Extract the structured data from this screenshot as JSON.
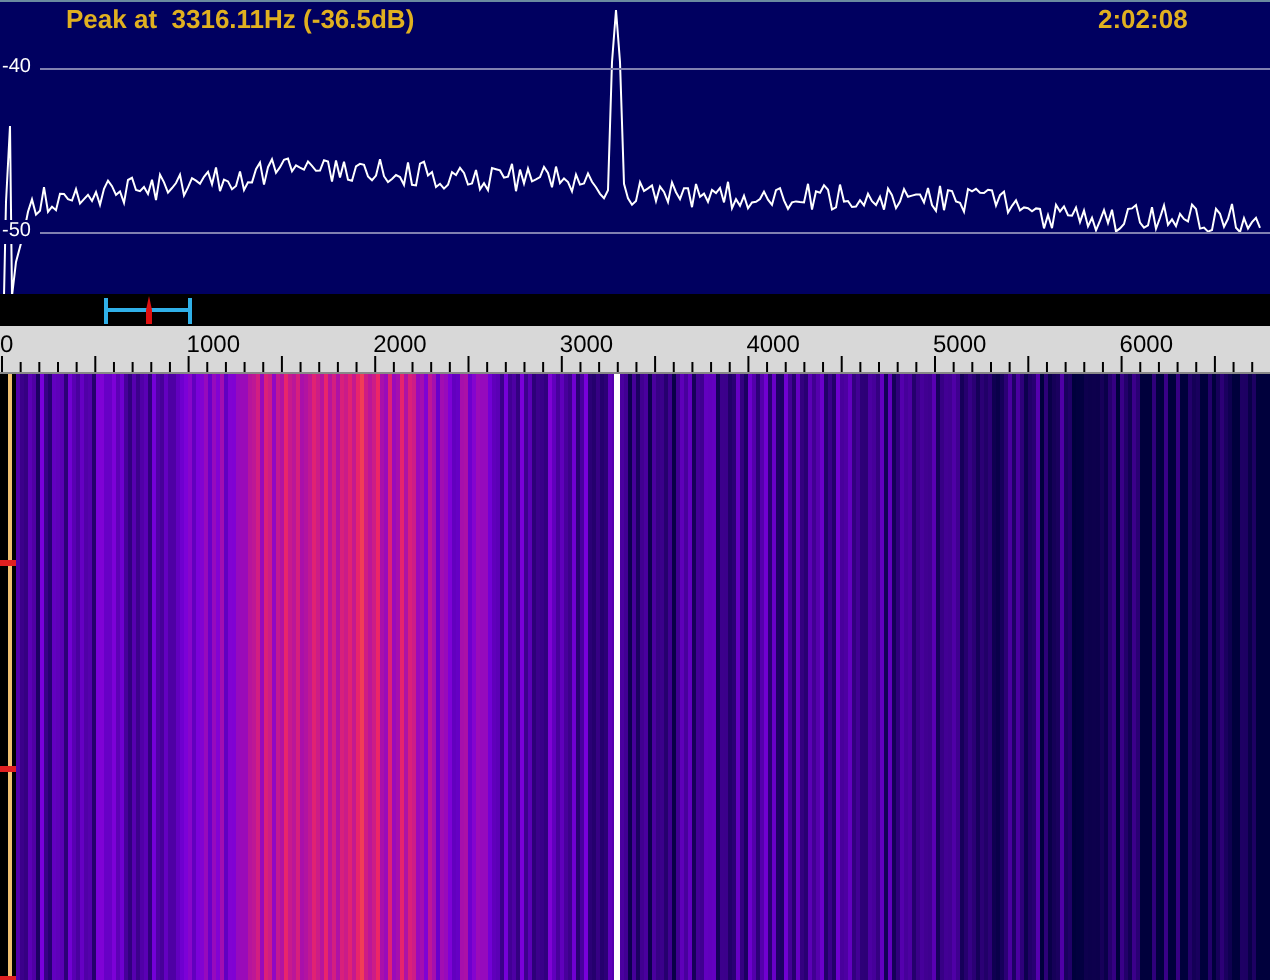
{
  "spectrum": {
    "peak_readout": "Peak at  3316.11Hz (-36.5dB)",
    "clock": "2:02:08",
    "level_labels": [
      "-40",
      "-50"
    ]
  },
  "frequency_ruler": {
    "labels": [
      "0",
      "1000",
      "2000",
      "3000",
      "4000",
      "5000",
      "6000"
    ]
  }
}
